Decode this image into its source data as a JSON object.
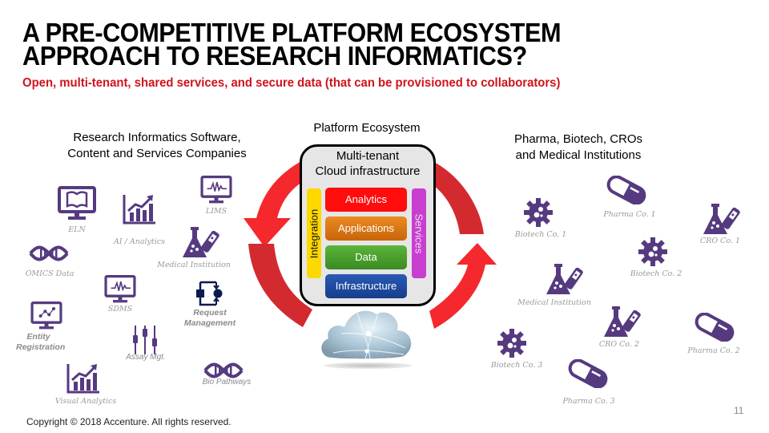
{
  "title_line1": "A PRE-COMPETITIVE PLATFORM ECOSYSTEM",
  "title_line2": "APPROACH TO RESEARCH INFORMATICS?",
  "subtitle": "Open, multi-tenant, shared services, and  secure data (that can be provisioned to collaborators)",
  "left_heading_line1": "Research Informatics Software,",
  "left_heading_line2": "Content and Services Companies",
  "center_heading": "Platform Ecosystem",
  "right_heading_line1": "Pharma, Biotech, CROs",
  "right_heading_line2": "and Medical Institutions",
  "platform": {
    "title_line1": "Multi-tenant",
    "title_line2": "Cloud infrastructure",
    "layers": [
      {
        "label": "Analytics",
        "color": "#ff0d0d"
      },
      {
        "label": "Applications",
        "color": "#e8801a"
      },
      {
        "label": "Data",
        "color": "#4aa12e"
      },
      {
        "label": "Infrastructure",
        "color": "#1f4ba5"
      }
    ],
    "integration": {
      "label": "Integration",
      "color": "#ffd800"
    },
    "services": {
      "label": "Services",
      "color": "#c83fd0"
    }
  },
  "left_items": [
    {
      "label": "ELN",
      "icon": "monitor-book-icon"
    },
    {
      "label": "AI / Analytics",
      "icon": "bar-chart-icon"
    },
    {
      "label": "LIMS",
      "icon": "monitor-pulse-icon"
    },
    {
      "label": "Medical Institution",
      "icon": "flask-icon"
    },
    {
      "label": "OMICS Data",
      "icon": "dna-icon"
    },
    {
      "label": "SDMS",
      "icon": "monitor-pulse-icon"
    },
    {
      "label": "Request",
      "label2": "Management",
      "icon": "workflow-icon"
    },
    {
      "label": "Entity",
      "label2": "Registration",
      "icon": "monitor-scatter-icon"
    },
    {
      "label": "Assay Mgt.",
      "icon": "sliders-icon"
    },
    {
      "label": "Bio Pathways",
      "icon": "dna-icon"
    },
    {
      "label": "Visual Analytics",
      "icon": "bar-chart-icon"
    }
  ],
  "right_items": [
    {
      "label": "Pharma Co. 1",
      "icon": "pill-icon"
    },
    {
      "label": "Biotech Co. 1",
      "icon": "virus-icon"
    },
    {
      "label": "CRO Co. 1",
      "icon": "flask-icon"
    },
    {
      "label": "Biotech Co. 2",
      "icon": "virus-icon"
    },
    {
      "label": "Medical Institution",
      "icon": "flask-icon"
    },
    {
      "label": "CRO Co. 2",
      "icon": "flask-icon"
    },
    {
      "label": "Pharma Co. 2",
      "icon": "pill-icon"
    },
    {
      "label": "Biotech Co. 3",
      "icon": "virus-icon"
    },
    {
      "label": "Pharma Co. 3",
      "icon": "pill-icon"
    }
  ],
  "colors": {
    "icon_purple": "#553a80",
    "arrow_light": "#f5282d",
    "arrow_dark": "#d32a30",
    "subtitle_red": "#d0141c"
  },
  "copyright": "Copyright © 2018 Accenture. All rights reserved.",
  "page_number": "11"
}
